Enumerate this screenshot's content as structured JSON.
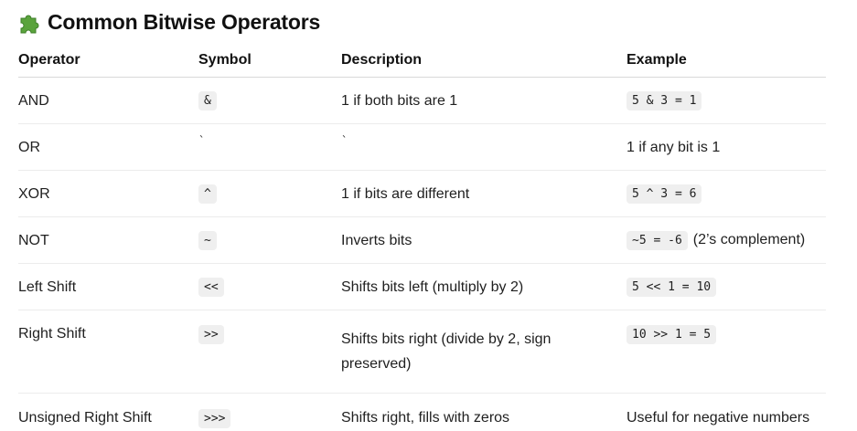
{
  "heading": {
    "icon": "puzzle-piece-icon",
    "text": "Common Bitwise Operators"
  },
  "table": {
    "headers": [
      "Operator",
      "Symbol",
      "Description",
      "Example"
    ],
    "rows": [
      {
        "operator": "AND",
        "symbol": "&",
        "description": "1 if both bits are 1",
        "example_code": "5 & 3 = 1",
        "example_note": ""
      },
      {
        "operator": "OR",
        "symbol": "`",
        "description": "`",
        "example_code": "",
        "example_note": "1 if any bit is 1"
      },
      {
        "operator": "XOR",
        "symbol": "^",
        "description": "1 if bits are different",
        "example_code": "5 ^ 3 = 6",
        "example_note": ""
      },
      {
        "operator": "NOT",
        "symbol": "~",
        "description": "Inverts bits",
        "example_code": "~5 = -6",
        "example_note": "(2’s complement)"
      },
      {
        "operator": "Left Shift",
        "symbol": "<<",
        "description": "Shifts bits left (multiply by 2)",
        "example_code": "5 << 1 = 10",
        "example_note": ""
      },
      {
        "operator": "Right Shift",
        "symbol": ">>",
        "description": "Shifts bits right (divide by 2, sign preserved)",
        "example_code": "10 >> 1 = 5",
        "example_note": ""
      },
      {
        "operator": "Unsigned Right Shift",
        "symbol": ">>>",
        "description": "Shifts right, fills with zeros",
        "example_code": "",
        "example_note": "Useful for negative numbers"
      }
    ]
  },
  "colors": {
    "code_bg": "#efefef",
    "header_rule": "#d9d9d9",
    "row_rule": "#ececec",
    "puzzle_green": "#5aa33c"
  }
}
